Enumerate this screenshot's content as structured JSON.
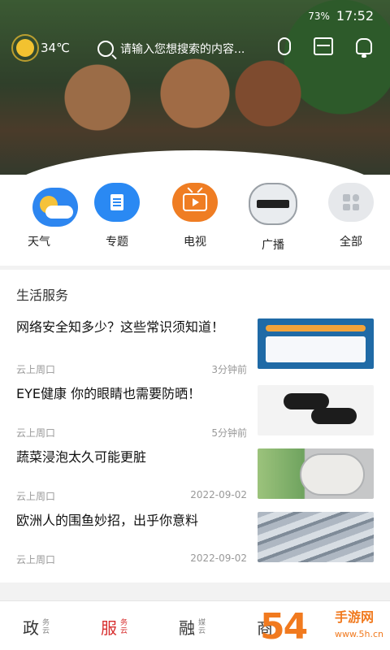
{
  "status_bar": {
    "left_icons": [
      "HD",
      "5G",
      "signal",
      "wifi",
      "qq",
      "app",
      "app2",
      "app3"
    ],
    "battery": "73%",
    "time": "17:52"
  },
  "header": {
    "temperature": "34℃",
    "search_placeholder": "请输入您想搜索的内容...",
    "carousel": {
      "count": 5,
      "active_index": 2
    }
  },
  "shortcuts": [
    {
      "label": "天气",
      "icon": "weather-icon"
    },
    {
      "label": "专题",
      "icon": "topic-icon"
    },
    {
      "label": "电视",
      "icon": "tv-icon"
    },
    {
      "label": "广播",
      "icon": "radio-icon"
    },
    {
      "label": "全部",
      "icon": "grid-icon"
    }
  ],
  "life_service": {
    "title": "生活服务",
    "items": [
      {
        "title": "网络安全知多少？这些常识须知道！",
        "source": "云上周口",
        "time": "3分钟前"
      },
      {
        "title": "EYE健康 你的眼睛也需要防晒！",
        "source": "云上周口",
        "time": "5分钟前"
      },
      {
        "title": "蔬菜浸泡太久可能更脏",
        "source": "云上周口",
        "time": "2022-09-02"
      },
      {
        "title": "欧洲人的围鱼妙招，出乎你意料",
        "source": "云上周口",
        "time": "2022-09-02"
      }
    ]
  },
  "bottom_tabs": [
    {
      "big": "政",
      "small": "务云"
    },
    {
      "big": "服",
      "small": "务云",
      "active": true
    },
    {
      "big": "融",
      "small": "媒云"
    },
    {
      "big": "商",
      "small": ""
    }
  ],
  "watermark": {
    "number": "54",
    "name": "手游网",
    "url": "www.5h.cn"
  }
}
